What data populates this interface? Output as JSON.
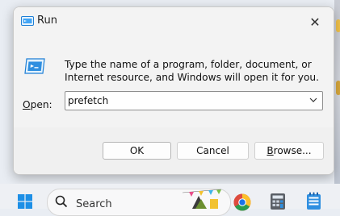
{
  "window": {
    "title": "Run",
    "close_glyph": "✕"
  },
  "dialog": {
    "description": "Type the name of a program, folder, document, or Internet resource, and Windows will open it for you.",
    "open_label_access": "O",
    "open_label_rest": "pen:",
    "open_value": "prefetch"
  },
  "buttons": {
    "ok": "OK",
    "cancel": "Cancel",
    "browse_access": "B",
    "browse_rest": "rowse..."
  },
  "taskbar": {
    "search_placeholder": "Search",
    "icons": [
      "windows-start-icon",
      "search-icon",
      "chrome-icon",
      "calculator-icon",
      "notepad-icon"
    ]
  },
  "colors": {
    "accent": "#1e7fd6",
    "dialog_bg": "#f3f3f3"
  }
}
